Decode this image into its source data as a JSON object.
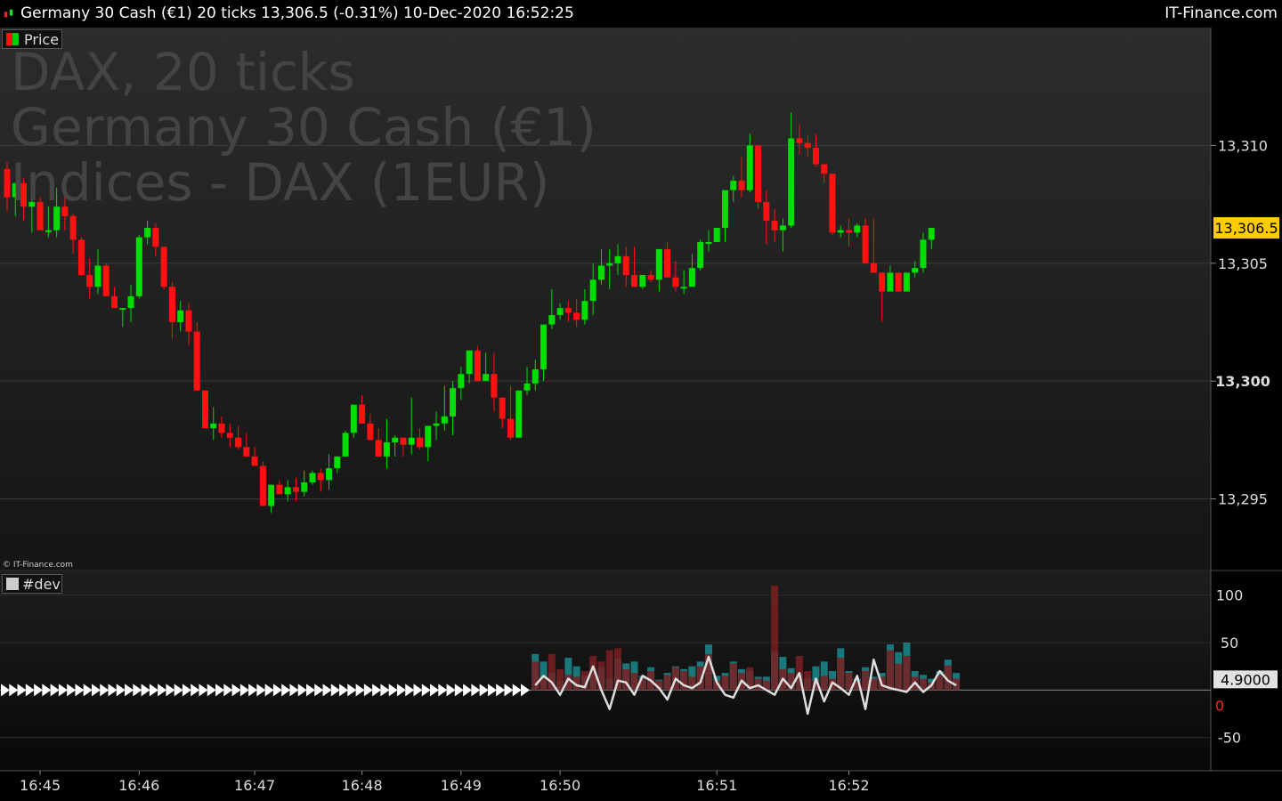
{
  "header": {
    "title": "Germany 30 Cash (€1) 20 ticks 13,306.5 (-0.31%) 10-Dec-2020 16:52:25",
    "brand": "IT-Finance.com"
  },
  "watermark": {
    "line1": "DAX, 20 ticks",
    "line2": "Germany 30 Cash (€1)",
    "line3": "Indices - DAX (1EUR)"
  },
  "price_panel": {
    "legend": "Price",
    "last_price_label": "13,306.5",
    "copyright": "© IT-Finance.com"
  },
  "indicator_panel": {
    "legend": "#dev",
    "value_label": "4.9000",
    "zero_label": "0"
  },
  "colors": {
    "up": "#00dd00",
    "down": "#ff1111",
    "last_price_bg": "#ffcc00",
    "bar_teal": "#1b8a8f",
    "bar_maroon": "#7a1e22",
    "line": "#dddddd"
  },
  "chart_data": [
    {
      "type": "candlestick",
      "title": "Price",
      "ylim": [
        13292,
        13315
      ],
      "y_ticks": [
        13295,
        13300,
        13305,
        13310
      ],
      "y_tick_labels": [
        "13,295",
        "13,300",
        "13,305",
        "13,310"
      ],
      "x_tick_labels": [
        "16:45",
        "16:46",
        "16:47",
        "16:48",
        "16:49",
        "16:50",
        "16:51",
        "16:52"
      ],
      "last_price": 13306.5,
      "ohlc": [
        [
          13309.0,
          13309.3,
          13307.2,
          13307.8
        ],
        [
          13307.8,
          13308.4,
          13307.0,
          13308.4
        ],
        [
          13308.4,
          13308.6,
          13306.8,
          13307.4
        ],
        [
          13307.4,
          13308.0,
          13306.3,
          13307.6
        ],
        [
          13307.6,
          13307.8,
          13306.4,
          13306.4
        ],
        [
          13306.4,
          13307.4,
          13306.1,
          13306.4
        ],
        [
          13306.4,
          13308.2,
          13306.1,
          13307.4
        ],
        [
          13307.4,
          13308.1,
          13306.4,
          13307.0
        ],
        [
          13307.0,
          13307.1,
          13305.4,
          13306.0
        ],
        [
          13306.0,
          13306.1,
          13304.5,
          13304.5
        ],
        [
          13304.5,
          13305.2,
          13303.5,
          13304.0
        ],
        [
          13304.0,
          13305.6,
          13303.7,
          13304.9
        ],
        [
          13304.9,
          13305.0,
          13303.8,
          13303.6
        ],
        [
          13303.6,
          13304.0,
          13303.2,
          13303.1
        ],
        [
          13303.1,
          13303.1,
          13302.3,
          13303.1
        ],
        [
          13303.1,
          13304.1,
          13302.5,
          13303.6
        ],
        [
          13303.6,
          13306.2,
          13303.5,
          13306.1
        ],
        [
          13306.1,
          13306.8,
          13305.8,
          13306.5
        ],
        [
          13306.5,
          13306.7,
          13305.3,
          13305.7
        ],
        [
          13305.7,
          13305.7,
          13303.9,
          13304.0
        ],
        [
          13304.0,
          13304.2,
          13301.8,
          13302.5
        ],
        [
          13302.5,
          13303.4,
          13302.1,
          13303.0
        ],
        [
          13303.0,
          13303.3,
          13301.5,
          13302.1
        ],
        [
          13302.1,
          13302.5,
          13299.6,
          13299.6
        ],
        [
          13299.6,
          13299.6,
          13298.0,
          13298.0
        ],
        [
          13298.0,
          13298.9,
          13297.5,
          13298.2
        ],
        [
          13298.2,
          13298.5,
          13297.6,
          13297.8
        ],
        [
          13297.8,
          13298.2,
          13297.2,
          13297.6
        ],
        [
          13297.6,
          13298.1,
          13297.1,
          13297.2
        ],
        [
          13297.2,
          13297.8,
          13296.8,
          13296.8
        ],
        [
          13296.8,
          13297.2,
          13296.4,
          13296.4
        ],
        [
          13296.4,
          13296.6,
          13294.7,
          13294.7
        ],
        [
          13294.7,
          13295.2,
          13294.4,
          13295.6
        ],
        [
          13295.6,
          13295.8,
          13295.2,
          13295.2
        ],
        [
          13295.2,
          13295.8,
          13294.9,
          13295.5
        ],
        [
          13295.5,
          13295.9,
          13294.9,
          13295.3
        ],
        [
          13295.3,
          13296.2,
          13295.1,
          13295.7
        ],
        [
          13295.7,
          13296.2,
          13295.6,
          13296.1
        ],
        [
          13296.1,
          13296.3,
          13295.3,
          13295.8
        ],
        [
          13295.8,
          13296.9,
          13295.4,
          13296.3
        ],
        [
          13296.3,
          13296.5,
          13296.1,
          13296.8
        ],
        [
          13296.8,
          13297.9,
          13296.8,
          13297.8
        ],
        [
          13297.8,
          13299.0,
          13297.6,
          13299.0
        ],
        [
          13299.0,
          13299.4,
          13298.2,
          13298.2
        ],
        [
          13298.2,
          13298.6,
          13297.5,
          13297.5
        ],
        [
          13297.5,
          13298.0,
          13296.8,
          13296.8
        ],
        [
          13296.8,
          13298.4,
          13296.3,
          13297.4
        ],
        [
          13297.4,
          13297.7,
          13296.8,
          13297.6
        ],
        [
          13297.6,
          13297.6,
          13296.8,
          13297.3
        ],
        [
          13297.3,
          13299.3,
          13296.9,
          13297.6
        ],
        [
          13297.6,
          13298.0,
          13297.1,
          13297.2
        ],
        [
          13297.2,
          13298.0,
          13296.6,
          13298.1
        ],
        [
          13298.1,
          13298.7,
          13297.5,
          13298.2
        ],
        [
          13298.2,
          13299.8,
          13297.9,
          13298.5
        ],
        [
          13298.5,
          13300.0,
          13297.7,
          13299.7
        ],
        [
          13299.7,
          13300.6,
          13299.2,
          13300.3
        ],
        [
          13300.3,
          13301.3,
          13299.9,
          13301.3
        ],
        [
          13301.3,
          13301.5,
          13300.5,
          13300.0
        ],
        [
          13300.0,
          13301.2,
          13300.2,
          13300.3
        ],
        [
          13300.3,
          13301.2,
          13298.7,
          13299.3
        ],
        [
          13299.3,
          13299.3,
          13298.0,
          13298.4
        ],
        [
          13298.4,
          13299.8,
          13297.5,
          13297.6
        ],
        [
          13297.6,
          13297.6,
          13299.6,
          13299.6
        ],
        [
          13299.6,
          13300.6,
          13299.4,
          13299.9
        ],
        [
          13299.9,
          13300.9,
          13299.6,
          13300.5
        ],
        [
          13300.5,
          13302.4,
          13300.0,
          13302.4
        ],
        [
          13302.4,
          13303.9,
          13302.2,
          13302.8
        ],
        [
          13302.8,
          13303.3,
          13302.6,
          13303.1
        ],
        [
          13303.1,
          13303.4,
          13302.5,
          13302.9
        ],
        [
          13302.9,
          13303.5,
          13302.3,
          13302.6
        ],
        [
          13302.6,
          13303.9,
          13302.4,
          13303.4
        ],
        [
          13303.4,
          13305.0,
          13302.8,
          13304.3
        ],
        [
          13304.3,
          13305.6,
          13304.1,
          13304.9
        ],
        [
          13304.9,
          13305.6,
          13303.9,
          13305.0
        ],
        [
          13305.0,
          13305.8,
          13304.5,
          13305.3
        ],
        [
          13305.3,
          13305.7,
          13304.0,
          13304.5
        ],
        [
          13304.5,
          13305.7,
          13304.4,
          13304.0
        ],
        [
          13304.0,
          13304.4,
          13303.9,
          13304.5
        ],
        [
          13304.5,
          13304.7,
          13304.2,
          13304.3
        ],
        [
          13304.3,
          13305.6,
          13303.8,
          13305.6
        ],
        [
          13305.6,
          13305.9,
          13304.4,
          13304.4
        ],
        [
          13304.4,
          13305.1,
          13303.8,
          13304.0
        ],
        [
          13304.0,
          13304.7,
          13303.7,
          13304.0
        ],
        [
          13304.0,
          13305.4,
          13304.3,
          13304.8
        ],
        [
          13304.8,
          13306.0,
          13304.7,
          13305.9
        ],
        [
          13305.9,
          13306.4,
          13305.5,
          13305.9
        ],
        [
          13305.9,
          13306.5,
          13306.2,
          13306.5
        ],
        [
          13306.5,
          13308.0,
          13305.9,
          13308.1
        ],
        [
          13308.1,
          13308.7,
          13307.6,
          13308.5
        ],
        [
          13308.5,
          13309.5,
          13307.8,
          13308.1
        ],
        [
          13308.1,
          13310.5,
          13308.0,
          13310.0
        ],
        [
          13310.0,
          13310.0,
          13307.3,
          13307.6
        ],
        [
          13307.6,
          13308.1,
          13305.8,
          13306.8
        ],
        [
          13306.8,
          13307.3,
          13305.9,
          13306.4
        ],
        [
          13306.4,
          13306.9,
          13305.5,
          13306.6
        ],
        [
          13306.6,
          13311.4,
          13306.5,
          13310.3
        ],
        [
          13310.3,
          13310.9,
          13309.6,
          13310.1
        ],
        [
          13310.1,
          13310.4,
          13309.5,
          13309.9
        ],
        [
          13309.9,
          13310.5,
          13309.1,
          13309.2
        ],
        [
          13309.2,
          13308.9,
          13308.4,
          13308.8
        ],
        [
          13308.8,
          13308.2,
          13306.2,
          13306.3
        ],
        [
          13306.3,
          13306.6,
          13306.1,
          13306.4
        ],
        [
          13306.4,
          13306.9,
          13305.7,
          13306.3
        ],
        [
          13306.3,
          13306.7,
          13306.1,
          13306.6
        ],
        [
          13306.6,
          13306.9,
          13305.6,
          13305.0
        ],
        [
          13305.0,
          13306.9,
          13305.5,
          13304.6
        ],
        [
          13304.6,
          13304.1,
          13302.5,
          13303.8
        ],
        [
          13303.8,
          13304.9,
          13304.0,
          13304.6
        ],
        [
          13304.6,
          13304.4,
          13303.8,
          13303.8
        ],
        [
          13303.8,
          13304.6,
          13304.0,
          13304.6
        ],
        [
          13304.6,
          13305.1,
          13304.4,
          13304.8
        ],
        [
          13304.8,
          13306.3,
          13304.6,
          13306.0
        ],
        [
          13306.0,
          13306.5,
          13305.6,
          13306.5
        ]
      ]
    },
    {
      "type": "bar+line",
      "title": "#dev",
      "ylim": [
        -85,
        125
      ],
      "y_ticks": [
        100,
        50,
        -50
      ],
      "y_tick_labels": [
        "100",
        "50",
        "-50"
      ],
      "last_value": 4.9,
      "bar_start_index": 64,
      "bars_teal": [
        38,
        30,
        18,
        10,
        34,
        25,
        15,
        20,
        24,
        12,
        33,
        28,
        30,
        15,
        24,
        11,
        18,
        25,
        22,
        25,
        30,
        48,
        15,
        18,
        30,
        22,
        20,
        14,
        14,
        40,
        35,
        23,
        18,
        12,
        25,
        30,
        20,
        44,
        20,
        12,
        24,
        14,
        18,
        48,
        40,
        50,
        20,
        16,
        12,
        20,
        32,
        18
      ],
      "bars_maroon": [
        30,
        12,
        38,
        22,
        16,
        14,
        20,
        36,
        30,
        42,
        44,
        22,
        18,
        12,
        20,
        10,
        16,
        24,
        20,
        14,
        25,
        38,
        10,
        15,
        28,
        18,
        24,
        12,
        10,
        110,
        22,
        18,
        36,
        20,
        10,
        15,
        12,
        34,
        18,
        10,
        20,
        12,
        14,
        42,
        28,
        36,
        14,
        12,
        8,
        16,
        26,
        12
      ],
      "line": [
        5,
        15,
        8,
        -5,
        12,
        5,
        3,
        25,
        0,
        -20,
        10,
        8,
        -5,
        15,
        10,
        2,
        -10,
        12,
        5,
        2,
        8,
        35,
        8,
        -5,
        -8,
        10,
        2,
        5,
        0,
        -5,
        12,
        2,
        18,
        -25,
        12,
        -12,
        8,
        2,
        -5,
        15,
        -20,
        32,
        5,
        2,
        0,
        -2,
        8,
        -2,
        5,
        20,
        10,
        4.9
      ]
    }
  ]
}
